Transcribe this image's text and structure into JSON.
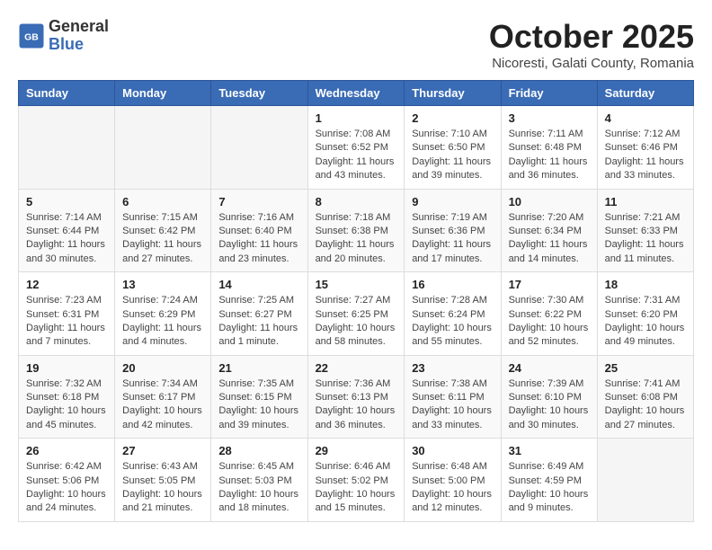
{
  "header": {
    "logo_general": "General",
    "logo_blue": "Blue",
    "month": "October 2025",
    "location": "Nicoresti, Galati County, Romania"
  },
  "weekdays": [
    "Sunday",
    "Monday",
    "Tuesday",
    "Wednesday",
    "Thursday",
    "Friday",
    "Saturday"
  ],
  "weeks": [
    [
      {
        "day": "",
        "info": ""
      },
      {
        "day": "",
        "info": ""
      },
      {
        "day": "",
        "info": ""
      },
      {
        "day": "1",
        "info": "Sunrise: 7:08 AM\nSunset: 6:52 PM\nDaylight: 11 hours and 43 minutes."
      },
      {
        "day": "2",
        "info": "Sunrise: 7:10 AM\nSunset: 6:50 PM\nDaylight: 11 hours and 39 minutes."
      },
      {
        "day": "3",
        "info": "Sunrise: 7:11 AM\nSunset: 6:48 PM\nDaylight: 11 hours and 36 minutes."
      },
      {
        "day": "4",
        "info": "Sunrise: 7:12 AM\nSunset: 6:46 PM\nDaylight: 11 hours and 33 minutes."
      }
    ],
    [
      {
        "day": "5",
        "info": "Sunrise: 7:14 AM\nSunset: 6:44 PM\nDaylight: 11 hours and 30 minutes."
      },
      {
        "day": "6",
        "info": "Sunrise: 7:15 AM\nSunset: 6:42 PM\nDaylight: 11 hours and 27 minutes."
      },
      {
        "day": "7",
        "info": "Sunrise: 7:16 AM\nSunset: 6:40 PM\nDaylight: 11 hours and 23 minutes."
      },
      {
        "day": "8",
        "info": "Sunrise: 7:18 AM\nSunset: 6:38 PM\nDaylight: 11 hours and 20 minutes."
      },
      {
        "day": "9",
        "info": "Sunrise: 7:19 AM\nSunset: 6:36 PM\nDaylight: 11 hours and 17 minutes."
      },
      {
        "day": "10",
        "info": "Sunrise: 7:20 AM\nSunset: 6:34 PM\nDaylight: 11 hours and 14 minutes."
      },
      {
        "day": "11",
        "info": "Sunrise: 7:21 AM\nSunset: 6:33 PM\nDaylight: 11 hours and 11 minutes."
      }
    ],
    [
      {
        "day": "12",
        "info": "Sunrise: 7:23 AM\nSunset: 6:31 PM\nDaylight: 11 hours and 7 minutes."
      },
      {
        "day": "13",
        "info": "Sunrise: 7:24 AM\nSunset: 6:29 PM\nDaylight: 11 hours and 4 minutes."
      },
      {
        "day": "14",
        "info": "Sunrise: 7:25 AM\nSunset: 6:27 PM\nDaylight: 11 hours and 1 minute."
      },
      {
        "day": "15",
        "info": "Sunrise: 7:27 AM\nSunset: 6:25 PM\nDaylight: 10 hours and 58 minutes."
      },
      {
        "day": "16",
        "info": "Sunrise: 7:28 AM\nSunset: 6:24 PM\nDaylight: 10 hours and 55 minutes."
      },
      {
        "day": "17",
        "info": "Sunrise: 7:30 AM\nSunset: 6:22 PM\nDaylight: 10 hours and 52 minutes."
      },
      {
        "day": "18",
        "info": "Sunrise: 7:31 AM\nSunset: 6:20 PM\nDaylight: 10 hours and 49 minutes."
      }
    ],
    [
      {
        "day": "19",
        "info": "Sunrise: 7:32 AM\nSunset: 6:18 PM\nDaylight: 10 hours and 45 minutes."
      },
      {
        "day": "20",
        "info": "Sunrise: 7:34 AM\nSunset: 6:17 PM\nDaylight: 10 hours and 42 minutes."
      },
      {
        "day": "21",
        "info": "Sunrise: 7:35 AM\nSunset: 6:15 PM\nDaylight: 10 hours and 39 minutes."
      },
      {
        "day": "22",
        "info": "Sunrise: 7:36 AM\nSunset: 6:13 PM\nDaylight: 10 hours and 36 minutes."
      },
      {
        "day": "23",
        "info": "Sunrise: 7:38 AM\nSunset: 6:11 PM\nDaylight: 10 hours and 33 minutes."
      },
      {
        "day": "24",
        "info": "Sunrise: 7:39 AM\nSunset: 6:10 PM\nDaylight: 10 hours and 30 minutes."
      },
      {
        "day": "25",
        "info": "Sunrise: 7:41 AM\nSunset: 6:08 PM\nDaylight: 10 hours and 27 minutes."
      }
    ],
    [
      {
        "day": "26",
        "info": "Sunrise: 6:42 AM\nSunset: 5:06 PM\nDaylight: 10 hours and 24 minutes."
      },
      {
        "day": "27",
        "info": "Sunrise: 6:43 AM\nSunset: 5:05 PM\nDaylight: 10 hours and 21 minutes."
      },
      {
        "day": "28",
        "info": "Sunrise: 6:45 AM\nSunset: 5:03 PM\nDaylight: 10 hours and 18 minutes."
      },
      {
        "day": "29",
        "info": "Sunrise: 6:46 AM\nSunset: 5:02 PM\nDaylight: 10 hours and 15 minutes."
      },
      {
        "day": "30",
        "info": "Sunrise: 6:48 AM\nSunset: 5:00 PM\nDaylight: 10 hours and 12 minutes."
      },
      {
        "day": "31",
        "info": "Sunrise: 6:49 AM\nSunset: 4:59 PM\nDaylight: 10 hours and 9 minutes."
      },
      {
        "day": "",
        "info": ""
      }
    ]
  ]
}
